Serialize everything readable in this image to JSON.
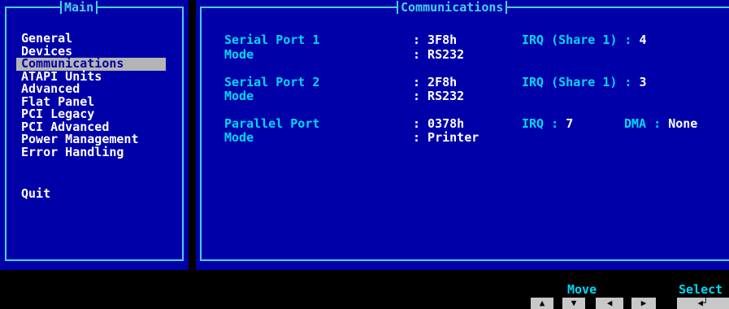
{
  "menu": {
    "title": "Main",
    "items": [
      {
        "label": "General"
      },
      {
        "label": "Devices"
      },
      {
        "label": "Communications",
        "selected": true
      },
      {
        "label": "ATAPI Units"
      },
      {
        "label": "Advanced"
      },
      {
        "label": "Flat Panel"
      },
      {
        "label": "PCI Legacy"
      },
      {
        "label": "PCI Advanced"
      },
      {
        "label": "Power Management"
      },
      {
        "label": "Error Handling"
      }
    ],
    "quit_label": "Quit"
  },
  "content": {
    "title": "Communications",
    "serial1": {
      "label": "Serial Port 1",
      "value": ": 3F8h",
      "irq_label": "IRQ (Share 1) :",
      "irq_value": "4",
      "mode_label": "Mode",
      "mode_value": ": RS232"
    },
    "serial2": {
      "label": "Serial Port 2",
      "value": ": 2F8h",
      "irq_label": "IRQ (Share 1) :",
      "irq_value": "3",
      "mode_label": "Mode",
      "mode_value": ": RS232"
    },
    "parallel": {
      "label": "Parallel Port",
      "value": ": 0378h",
      "irq_label": "IRQ :",
      "irq_value": "7",
      "dma_label": "DMA :",
      "dma_value": "None",
      "mode_label": "Mode",
      "mode_value": ": Printer"
    }
  },
  "status_bar": {
    "move_label": "Move",
    "select_label": "Select",
    "keys": {
      "up": "▲",
      "down": "▼",
      "left": "◀",
      "right": "▶",
      "enter": "◀┘"
    }
  },
  "colors": {
    "background": "#000000",
    "panel": "#0000a8",
    "border": "#4ad0f0",
    "label": "#00d8f8",
    "value": "#ffffff",
    "highlight": "#b4b4b4"
  }
}
